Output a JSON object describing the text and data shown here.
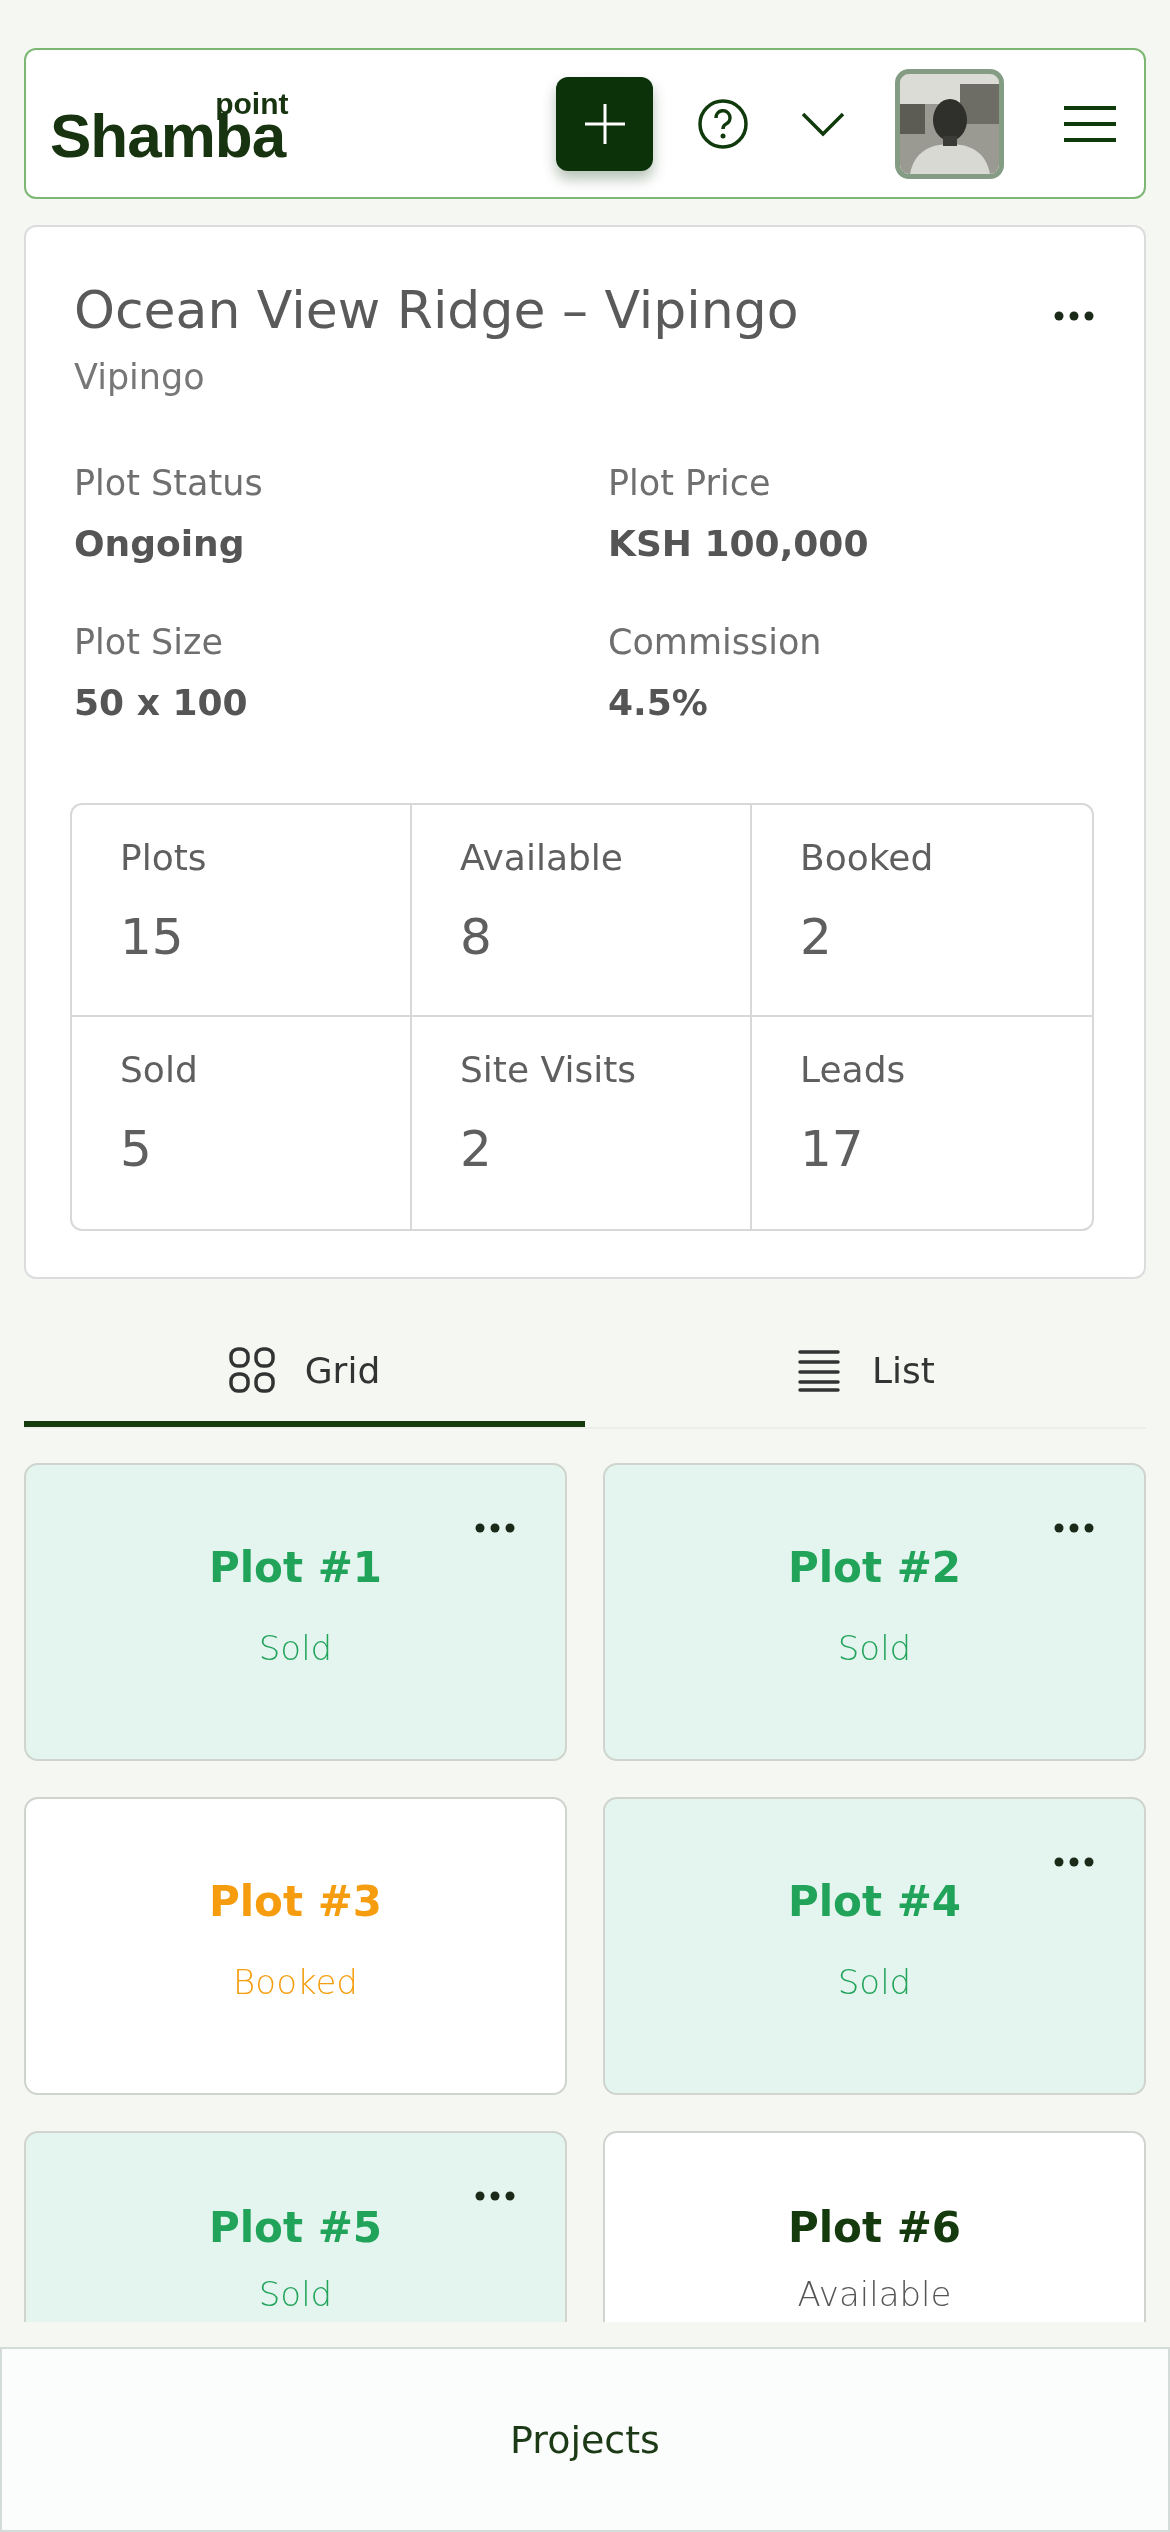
{
  "header": {
    "logo": {
      "main": "Shamba",
      "sup": "point"
    }
  },
  "project": {
    "title": "Ocean View Ridge – Vipingo",
    "location": "Vipingo",
    "details": [
      {
        "label": "Plot Status",
        "value": "Ongoing"
      },
      {
        "label": "Plot Price",
        "value": "KSH 100,000"
      },
      {
        "label": "Plot Size",
        "value": "50 x 100"
      },
      {
        "label": "Commission",
        "value": "4.5%"
      }
    ],
    "stats": [
      {
        "label": "Plots",
        "value": "15"
      },
      {
        "label": "Available",
        "value": "8"
      },
      {
        "label": "Booked",
        "value": "2"
      },
      {
        "label": "Sold",
        "value": "5"
      },
      {
        "label": "Site Visits",
        "value": "2"
      },
      {
        "label": "Leads",
        "value": "17"
      }
    ]
  },
  "view_tabs": [
    {
      "label": "Grid",
      "kind": "grid",
      "selected": true
    },
    {
      "label": "List",
      "kind": "list",
      "selected": false
    }
  ],
  "plots": [
    {
      "title": "Plot #1",
      "status": "Sold",
      "kind": "sold",
      "menu": true
    },
    {
      "title": "Plot #2",
      "status": "Sold",
      "kind": "sold",
      "menu": true
    },
    {
      "title": "Plot #3",
      "status": "Booked",
      "kind": "booked",
      "menu": false
    },
    {
      "title": "Plot #4",
      "status": "Sold",
      "kind": "sold",
      "menu": true
    },
    {
      "title": "Plot #5",
      "status": "Sold",
      "kind": "sold",
      "menu": true
    },
    {
      "title": "Plot #6",
      "status": "Available",
      "kind": "available",
      "menu": false
    }
  ],
  "bottom_bar": {
    "label": "Projects"
  }
}
